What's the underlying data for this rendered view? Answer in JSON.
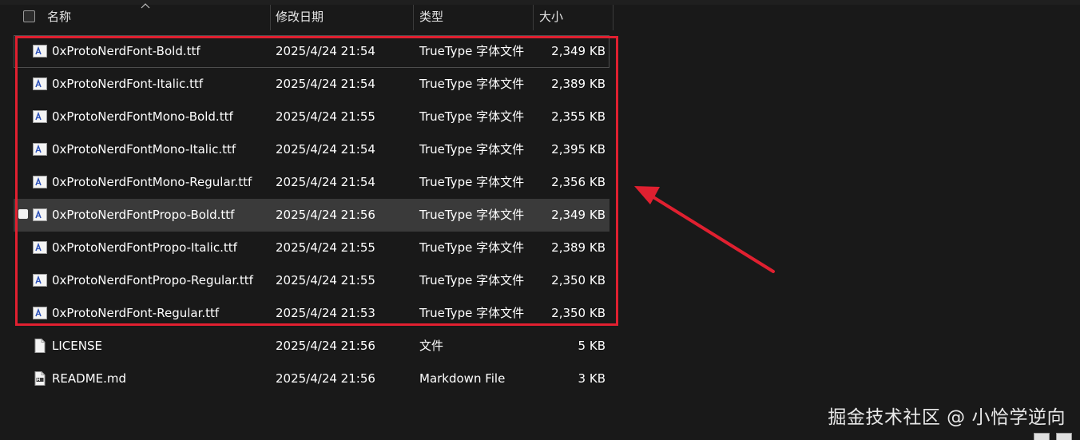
{
  "columns": {
    "name": "名称",
    "date": "修改日期",
    "type": "类型",
    "size": "大小"
  },
  "files": [
    {
      "name": "0xProtoNerdFont-Bold.ttf",
      "date": "2025/4/24 21:54",
      "type": "TrueType 字体文件",
      "size": "2,349 KB",
      "icon": "font-file-icon"
    },
    {
      "name": "0xProtoNerdFont-Italic.ttf",
      "date": "2025/4/24 21:54",
      "type": "TrueType 字体文件",
      "size": "2,389 KB",
      "icon": "font-file-icon"
    },
    {
      "name": "0xProtoNerdFontMono-Bold.ttf",
      "date": "2025/4/24 21:55",
      "type": "TrueType 字体文件",
      "size": "2,355 KB",
      "icon": "font-file-icon"
    },
    {
      "name": "0xProtoNerdFontMono-Italic.ttf",
      "date": "2025/4/24 21:54",
      "type": "TrueType 字体文件",
      "size": "2,395 KB",
      "icon": "font-file-icon"
    },
    {
      "name": "0xProtoNerdFontMono-Regular.ttf",
      "date": "2025/4/24 21:54",
      "type": "TrueType 字体文件",
      "size": "2,356 KB",
      "icon": "font-file-icon"
    },
    {
      "name": "0xProtoNerdFontPropo-Bold.ttf",
      "date": "2025/4/24 21:56",
      "type": "TrueType 字体文件",
      "size": "2,349 KB",
      "icon": "font-file-icon"
    },
    {
      "name": "0xProtoNerdFontPropo-Italic.ttf",
      "date": "2025/4/24 21:55",
      "type": "TrueType 字体文件",
      "size": "2,389 KB",
      "icon": "font-file-icon"
    },
    {
      "name": "0xProtoNerdFontPropo-Regular.ttf",
      "date": "2025/4/24 21:55",
      "type": "TrueType 字体文件",
      "size": "2,350 KB",
      "icon": "font-file-icon"
    },
    {
      "name": "0xProtoNerdFont-Regular.ttf",
      "date": "2025/4/24 21:53",
      "type": "TrueType 字体文件",
      "size": "2,350 KB",
      "icon": "font-file-icon"
    },
    {
      "name": "LICENSE",
      "date": "2025/4/24 21:56",
      "type": "文件",
      "size": "5 KB",
      "icon": "blank-file-icon"
    },
    {
      "name": "README.md",
      "date": "2025/4/24 21:56",
      "type": "Markdown File",
      "size": "3 KB",
      "icon": "markdown-file-icon"
    }
  ],
  "watermark": "掘金技术社区 @ 小恰学逆向",
  "colors": {
    "background": "#191919",
    "highlight": "#e02030",
    "hover_row": "#3a3a3a"
  }
}
